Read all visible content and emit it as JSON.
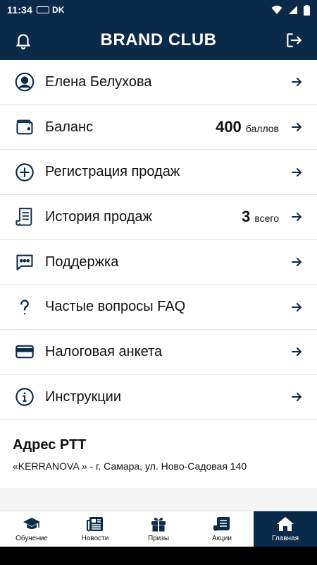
{
  "status": {
    "time": "11:34",
    "carrier": "DK"
  },
  "header": {
    "title": "BRAND CLUB"
  },
  "menu": [
    {
      "icon": "user-circle-icon",
      "label": "Елена Белухова"
    },
    {
      "icon": "wallet-icon",
      "label": "Баланс",
      "value": "400",
      "unit": "баллов"
    },
    {
      "icon": "plus-circle-icon",
      "label": "Регистрация продаж"
    },
    {
      "icon": "receipt-icon",
      "label": "История продаж",
      "value": "3",
      "unit": "всего"
    },
    {
      "icon": "chat-bubble-icon",
      "label": "Поддержка"
    },
    {
      "icon": "question-mark-icon",
      "label": "Частые вопросы FAQ"
    },
    {
      "icon": "credit-card-icon",
      "label": "Налоговая анкета"
    },
    {
      "icon": "info-circle-icon",
      "label": "Инструкции"
    }
  ],
  "address": {
    "title": "Адрес РТТ",
    "text": "«KERRANOVA » - г. Самара, ул. Ново-Садовая 140"
  },
  "tabs": [
    {
      "icon": "graduation-cap-icon",
      "label": "Обучение",
      "active": false
    },
    {
      "icon": "newspaper-icon",
      "label": "Новости",
      "active": false
    },
    {
      "icon": "gift-icon",
      "label": "Призы",
      "active": false
    },
    {
      "icon": "tickets-icon",
      "label": "Акции",
      "active": false
    },
    {
      "icon": "home-icon",
      "label": "Главная",
      "active": true
    }
  ],
  "colors": {
    "primary": "#0b2a4a",
    "background": "#ffffff",
    "divider": "#e6e6e6"
  }
}
